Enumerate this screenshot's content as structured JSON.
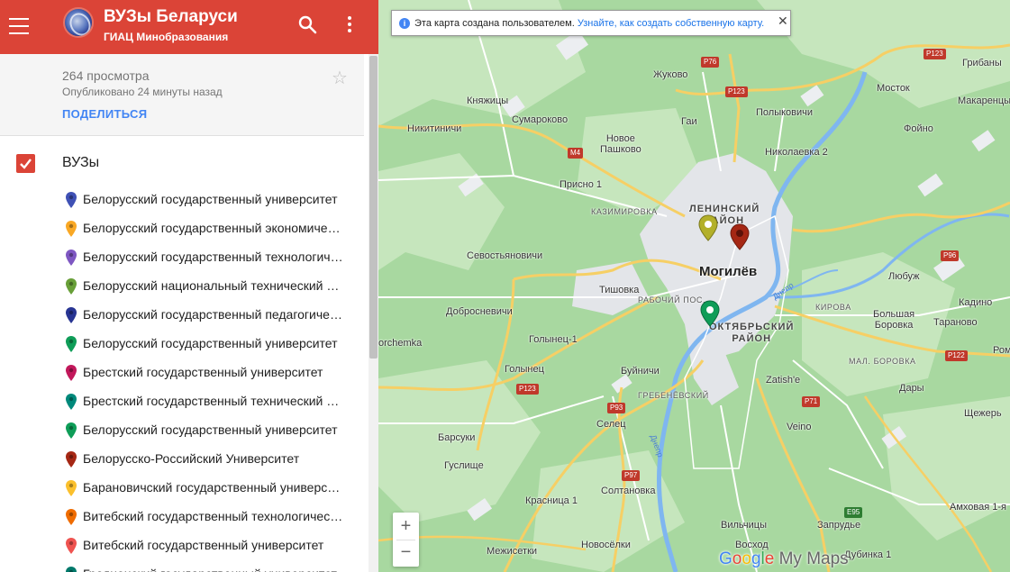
{
  "header": {
    "title": "ВУЗы Беларуси",
    "subtitle": "ГИАЦ Минобразования",
    "bg_color": "#db4437",
    "menu_icon": "hamburger-icon",
    "search_icon": "search-icon",
    "more_icon": "more-vert-icon"
  },
  "info": {
    "views": "264 просмотра",
    "published": "Опубликовано 24 минуты назад",
    "share_label": "ПОДЕЛИТЬСЯ",
    "star_icon": "star-outline-icon"
  },
  "layer": {
    "title": "ВУЗы",
    "checked": true,
    "items": [
      {
        "label": "Белорусский государственный университет",
        "color": "#3f51b5"
      },
      {
        "label": "Белорусский государственный экономический университет",
        "color": "#f9a825"
      },
      {
        "label": "Белорусский государственный технологический университет",
        "color": "#7e57c2"
      },
      {
        "label": "Белорусский национальный технический университет",
        "color": "#689f38"
      },
      {
        "label": "Белорусский государственный педагогический университет",
        "color": "#283593"
      },
      {
        "label": "Белорусский государственный университет",
        "color": "#0f9d58"
      },
      {
        "label": "Брестский государственный университет",
        "color": "#c2185b"
      },
      {
        "label": "Брестский государственный технический университет",
        "color": "#00897b"
      },
      {
        "label": "Белорусский государственный университет",
        "color": "#0f9d58"
      },
      {
        "label": "Белорусско-Российский Университет",
        "color": "#a52714"
      },
      {
        "label": "Барановичский государственный университет",
        "color": "#fbc02d"
      },
      {
        "label": "Витебский государственный технологический университет",
        "color": "#ef6c00"
      },
      {
        "label": "Витебский государственный университет",
        "color": "#ef5350"
      },
      {
        "label": "Гродненский государственный университет",
        "color": "#00796b"
      }
    ]
  },
  "map": {
    "banner_text": "Эта карта создана пользователем.",
    "banner_link": "Узнайте, как создать собственную карту.",
    "zoom_in": "+",
    "zoom_out": "−",
    "brand_google": "Google",
    "brand_mymaps": "My Maps",
    "city": "Могилёв",
    "districts": [
      "ЛЕНИНСКИЙ\nРАЙОН",
      "ОКТЯБРЬСКИЙ\nРАЙОН"
    ],
    "places": [
      "Жуково",
      "Княжицы",
      "Сумароково",
      "Гаи",
      "Полыковичи",
      "Никитиничи",
      "Новое\nПашково",
      "Николаевка 2",
      "Присно 1",
      "КАЗИМИРОВКА",
      "Севостьяновичи",
      "Тишовка",
      "РАБОЧИЙ ПОС.",
      "Добросневичи",
      "Голынец-1",
      "Голынец",
      "Буйничи",
      "ГРЕБЕНЁВСКИЙ",
      "Zatish'e",
      "Селец",
      "Барсуки",
      "Гуслище",
      "Красница 1",
      "Солтановка",
      "Вильчицы",
      "Запрудье",
      "Межисетки",
      "Новосёлки",
      "Восход",
      "Дубинка 1",
      "Veino",
      "Дары",
      "Щежерь",
      "Амховая 1-я",
      "Рома",
      "МАЛ. БОРОВКА",
      "КИРОВА",
      "Большая\nБоровка",
      "Тараново",
      "Кадино",
      "Любуж",
      "Фойно",
      "Макаренцы",
      "Мосток",
      "Грибаны",
      "orchemka"
    ],
    "roads": [
      "P76",
      "P123",
      "P123",
      "P123",
      "M4",
      "P96",
      "P122",
      "P71",
      "P93",
      "P97",
      "E95"
    ],
    "river": "Днепр"
  }
}
